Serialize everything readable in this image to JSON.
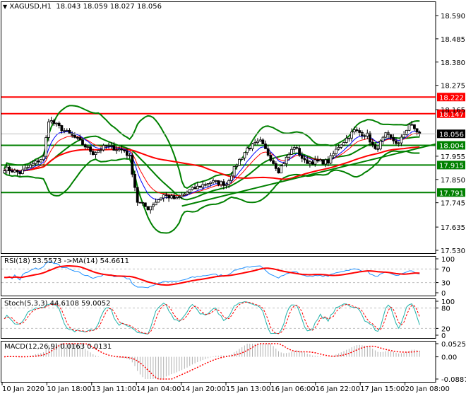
{
  "header": {
    "symbol": "XAGUSD,H1",
    "open": "18.043",
    "high": "18.059",
    "low": "18.027",
    "close": "18.056"
  },
  "colors": {
    "bull": "#ffffff",
    "bear": "#000000",
    "bands": "#008000",
    "level_red": "#ff0000",
    "level_green": "#008000",
    "rsi": "#1e90ff",
    "rsi_ma": "#ff0000",
    "stoch": "#20b2aa",
    "signal": "#ff0000",
    "hist": "#b0b0b0"
  },
  "chart_data": {
    "type": "candlestick",
    "title": "XAGUSD,H1",
    "ylim": [
      17.53,
      18.59
    ],
    "yticks": [
      "18.590",
      "18.485",
      "18.380",
      "18.275",
      "18.165",
      "17.955",
      "17.850",
      "17.745",
      "17.635",
      "17.530"
    ],
    "current_price": "18.056",
    "levels": [
      {
        "value": 18.222,
        "label": "18.222",
        "color": "red"
      },
      {
        "value": 18.147,
        "label": "18.147",
        "color": "red"
      },
      {
        "value": 18.004,
        "label": "18.004",
        "color": "green"
      },
      {
        "value": 17.915,
        "label": "17.915",
        "color": "green"
      },
      {
        "value": 17.791,
        "label": "17.791",
        "color": "green"
      }
    ],
    "trendline": {
      "from": {
        "bar": 68,
        "price": 17.73
      },
      "to": {
        "bar": 166,
        "price": 18.01
      }
    },
    "bars": 160,
    "close_waypoints": [
      {
        "bar": 0,
        "close": 17.9
      },
      {
        "bar": 6,
        "close": 17.88
      },
      {
        "bar": 15,
        "close": 17.95
      },
      {
        "bar": 17,
        "close": 18.12
      },
      {
        "bar": 23,
        "close": 18.07
      },
      {
        "bar": 28,
        "close": 18.03
      },
      {
        "bar": 34,
        "close": 17.97
      },
      {
        "bar": 39,
        "close": 18.0
      },
      {
        "bar": 46,
        "close": 17.98
      },
      {
        "bar": 48,
        "close": 17.95
      },
      {
        "bar": 51,
        "close": 17.75
      },
      {
        "bar": 55,
        "close": 17.72
      },
      {
        "bar": 61,
        "close": 17.78
      },
      {
        "bar": 66,
        "close": 17.76
      },
      {
        "bar": 71,
        "close": 17.8
      },
      {
        "bar": 79,
        "close": 17.84
      },
      {
        "bar": 85,
        "close": 17.83
      },
      {
        "bar": 89,
        "close": 17.92
      },
      {
        "bar": 93,
        "close": 17.99
      },
      {
        "bar": 98,
        "close": 18.02
      },
      {
        "bar": 105,
        "close": 17.89
      },
      {
        "bar": 111,
        "close": 18.0
      },
      {
        "bar": 115,
        "close": 17.93
      },
      {
        "bar": 124,
        "close": 17.93
      },
      {
        "bar": 128,
        "close": 18.0
      },
      {
        "bar": 134,
        "close": 18.07
      },
      {
        "bar": 139,
        "close": 18.05
      },
      {
        "bar": 142,
        "close": 17.98
      },
      {
        "bar": 146,
        "close": 18.05
      },
      {
        "bar": 151,
        "close": 18.01
      },
      {
        "bar": 155,
        "close": 18.1
      },
      {
        "bar": 159,
        "close": 18.056
      }
    ],
    "xticks": [
      "10 Jan 2020",
      "10 Jan 18:00",
      "13 Jan 11:00",
      "14 Jan 04:00",
      "14 Jan 20:00",
      "15 Jan 13:00",
      "16 Jan 06:00",
      "16 Jan 22:00",
      "17 Jan 15:00",
      "20 Jan 08:00"
    ],
    "indicators": {
      "rsi": {
        "label": "RSI(18) 53.5573  ->MA(14) 54.6611",
        "ticks": [
          "100",
          "70",
          "30",
          "0"
        ],
        "ylim": [
          0,
          100
        ]
      },
      "stoch": {
        "label": "Stoch(5,3,3) 44.6108 59.0052",
        "ticks": [
          "100",
          "80",
          "20",
          "0"
        ],
        "ylim": [
          0,
          100
        ]
      },
      "macd": {
        "label": "MACD(12,26,9) 0.0163 0.0131",
        "ticks": [
          "0.0525",
          "0.00",
          "-0.0887"
        ],
        "ylim": [
          -0.0887,
          0.0525
        ]
      }
    }
  }
}
